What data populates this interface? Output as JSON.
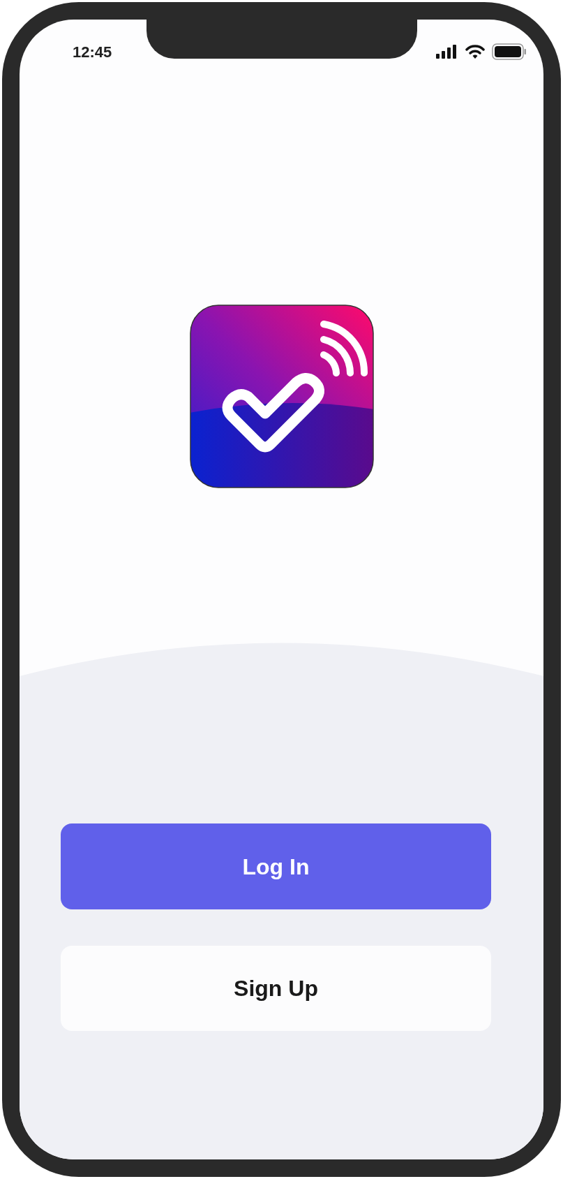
{
  "status_bar": {
    "time": "12:45"
  },
  "buttons": [
    {
      "label": "Log In",
      "kind": "primary"
    },
    {
      "label": "Sign Up",
      "kind": "secondary"
    }
  ]
}
